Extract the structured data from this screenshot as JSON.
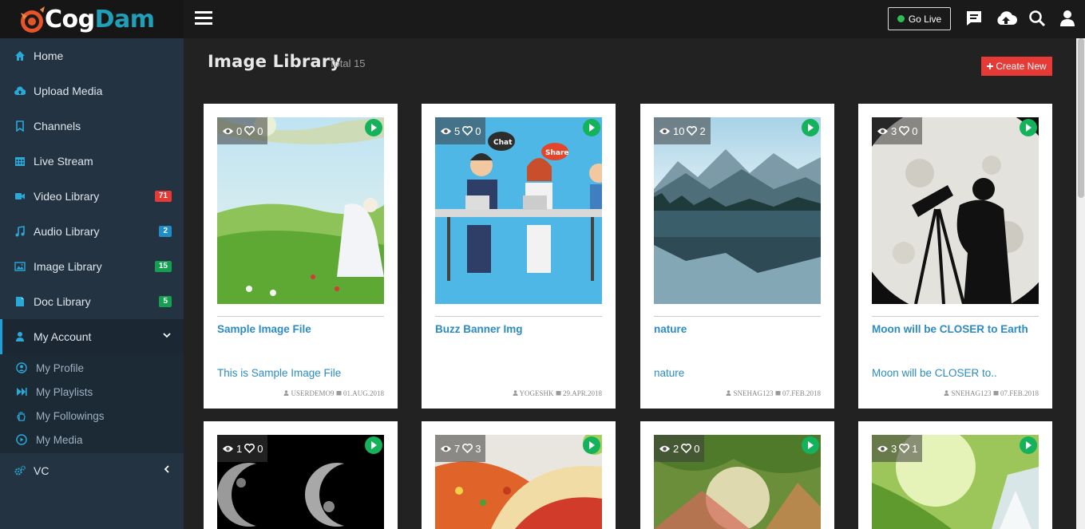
{
  "brand": {
    "part1": "Cog",
    "part2": "Dam"
  },
  "topbar": {
    "go_live": "Go Live"
  },
  "sidebar": {
    "items": [
      {
        "label": "Home",
        "icon": "home-icon"
      },
      {
        "label": "Upload Media",
        "icon": "cloud-upload-icon"
      },
      {
        "label": "Channels",
        "icon": "bookmark-icon"
      },
      {
        "label": "Live Stream",
        "icon": "calendar-icon"
      },
      {
        "label": "Video Library",
        "icon": "video-camera-icon",
        "badge": "71",
        "badge_color": "#e53a36"
      },
      {
        "label": "Audio Library",
        "icon": "music-icon",
        "badge": "2",
        "badge_color": "#1f8ec7"
      },
      {
        "label": "Image Library",
        "icon": "image-icon",
        "badge": "15",
        "badge_color": "#14a050"
      },
      {
        "label": "Doc Library",
        "icon": "document-icon",
        "badge": "5",
        "badge_color": "#14a050"
      },
      {
        "label": "My Account",
        "icon": "user-icon"
      }
    ],
    "sub_items": [
      {
        "label": "My Profile",
        "icon": "user-circle-icon"
      },
      {
        "label": "My Playlists",
        "icon": "fast-forward-icon"
      },
      {
        "label": "My Followings",
        "icon": "hand-icon"
      },
      {
        "label": "My Media",
        "icon": "play-circle-icon"
      }
    ],
    "vc": {
      "label": "VC",
      "icon": "gears-icon"
    }
  },
  "page": {
    "title": "Image Library",
    "subtitle": "Total 15",
    "create_label": "Create New"
  },
  "cards": [
    {
      "views": "0",
      "likes": "0",
      "title": "Sample Image File",
      "desc": "This is Sample Image File",
      "user": "USERDEMO9",
      "date": "01.AUG.2018",
      "scene": "meadow"
    },
    {
      "views": "5",
      "likes": "0",
      "title": "Buzz Banner Img",
      "desc": "",
      "user": "YOGESHK",
      "date": "29.APR.2018",
      "scene": "office"
    },
    {
      "views": "10",
      "likes": "2",
      "title": "nature",
      "desc": "nature",
      "user": "SNEHAG123",
      "date": "07.FEB.2018",
      "scene": "lake"
    },
    {
      "views": "3",
      "likes": "0",
      "title": "Moon will be CLOSER to Earth",
      "desc": "Moon will be CLOSER to..",
      "user": "SNEHAG123",
      "date": "07.FEB.2018",
      "scene": "moon"
    },
    {
      "views": "1",
      "likes": "0",
      "scene": "moons"
    },
    {
      "views": "7",
      "likes": "3",
      "scene": "food"
    },
    {
      "views": "2",
      "likes": "0",
      "scene": "forest"
    },
    {
      "views": "3",
      "likes": "1",
      "scene": "waterfall"
    }
  ]
}
